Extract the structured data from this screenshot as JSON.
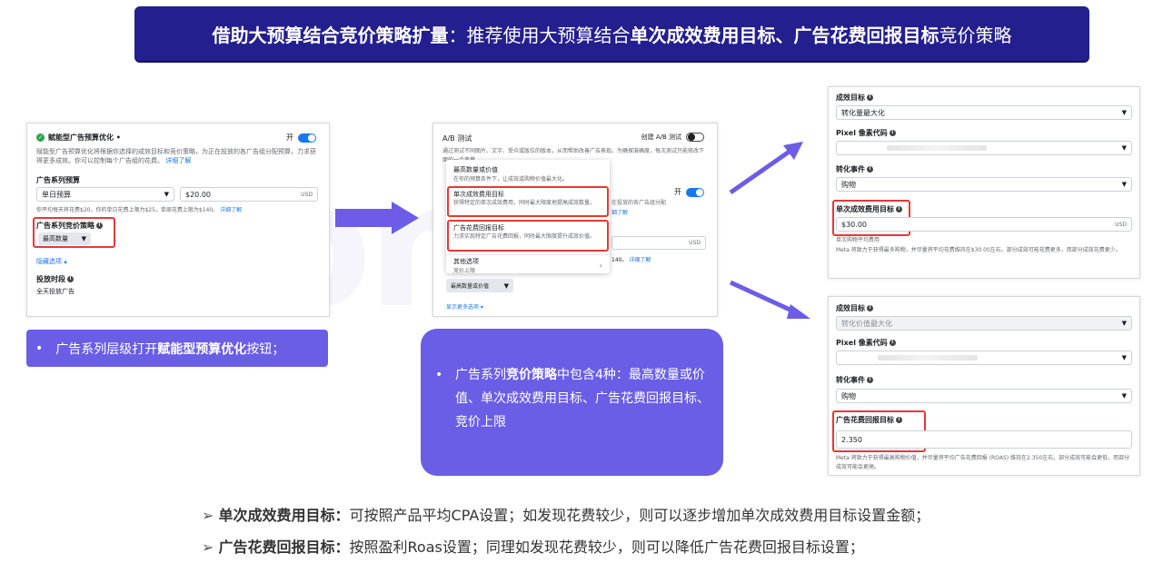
{
  "header": {
    "title_bold": "借助大预算结合竞价策略扩量",
    "title_mid": "：推荐使用大预算结合",
    "title_bold2": "单次成效费用目标、广告花费回报目标",
    "title_end": "竞价策略"
  },
  "watermark": "nomk",
  "panel1": {
    "title": "赋能型广告预算优化 •",
    "toggle_label": "开",
    "desc": "赋能型广告预算优化将根据你选择的成效目标和竞价策略，为正在投放的各广告组分配预算，力求获得更多成效。你可以控制每个广告组的花费。",
    "desc_link": "详细了解",
    "budget_label": "广告系列预算",
    "budget_type": "单日预算",
    "budget_value": "$20.00",
    "budget_unit": "USD",
    "budget_note": "你平均每天将花费$20。你的单日花费上限为$25，单周花费上限为$140。",
    "budget_note_link": "详细了解",
    "bid_label": "广告系列竞价策略",
    "bid_value": "最高数量",
    "hide_options": "隐藏选项 ▴",
    "schedule_label": "投放时段",
    "schedule_value": "全天投放广告"
  },
  "panel2": {
    "ab_title": "A/B 测试",
    "ab_toggle_label": "创建 A/B 测试",
    "ab_desc": "通过测试不同图片、文字、受众或版位的版本，从而帮助改善广告表现。为确保准确度，每次测试只能修改下面的一个变量。",
    "menu_items": [
      {
        "title": "最高数量或价值",
        "desc": "在你的预算条件下，让成效或购物价值最大化。"
      },
      {
        "title": "单次成效费用目标",
        "desc": "获得特定的单次成效费用，同时最大限度地提高成效数量。"
      },
      {
        "title": "广告花费回报目标",
        "desc": "力求实现特定广告花费回报，同时最大限度提升成效价值。"
      },
      {
        "title": "其他选项",
        "desc": "竞价上限"
      }
    ],
    "right_toggle_label": "开",
    "right_text": "在投放的各广告组分配",
    "right_link": "细了解",
    "right_unit": "USD",
    "right_note": "140。",
    "right_note_link": "详细了解",
    "bid_dropdown": "最高数量或价值",
    "show_more": "显示更多选项 ▾"
  },
  "panel3": {
    "goal_label": "成效目标",
    "goal_value": "转化量最大化",
    "pixel_label": "Pixel 像素代码",
    "event_label": "转化事件",
    "event_value": "购物",
    "cpa_label": "单次成效费用目标",
    "cpa_value": "$30.00",
    "cpa_unit": "USD",
    "avg_label": "单次购物平均费用",
    "note": "Meta 将致力于获得最多购物，并尽量将平均花费维持在$30.00左右。部分成效可能花费更多，而部分成效花费更少。"
  },
  "panel4": {
    "goal_label": "成效目标",
    "goal_value": "转化价值最大化",
    "pixel_label": "Pixel 像素代码",
    "event_label": "转化事件",
    "event_value": "购物",
    "roas_label": "广告花费回报目标",
    "roas_value": "2.350",
    "note": "Meta 将致力于获得最高购物价值，并尽量将平均广告花费回报 (ROAS) 维持在2.350左右。部分成效可能会更低，而部分成效可能会更高。"
  },
  "callout1": {
    "bullet": "•",
    "pre": "广告系列层级打开",
    "bold": "赋能型预算优化",
    "post": "按钮；"
  },
  "callout2": {
    "bullet": "•",
    "pre": "广告系列",
    "bold": "竞价策略",
    "post": "中包含4种：最高数量或价值、单次成效费用目标、广告花费回报目标、竞价上限"
  },
  "notes": [
    {
      "marker": "➢",
      "bold": "单次成效费用目标：",
      "text": "可按照产品平均CPA设置；如发现花费较少，则可以逐步增加单次成效费用目标设置金额；"
    },
    {
      "marker": "➢",
      "bold": "广告花费回报目标：",
      "text": "按照盈利Roas设置；同理如发现花费较少，则可以降低广告花费回报目标设置；"
    }
  ],
  "colors": {
    "banner": "#241f8e",
    "callout": "#6a5ee6",
    "arrow": "#6c5ce7",
    "highlight": "#e53935",
    "fb_blue": "#1877f2"
  }
}
